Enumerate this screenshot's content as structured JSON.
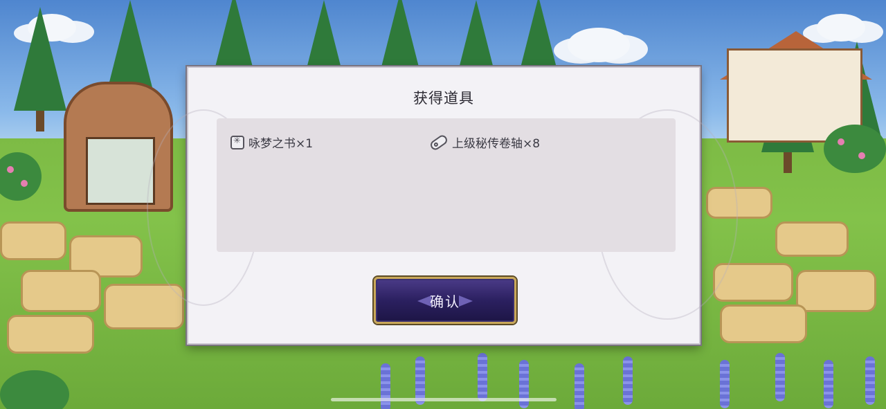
{
  "dialog": {
    "title": "获得道具",
    "items": [
      {
        "icon": "book-icon",
        "name": "咏梦之书×1"
      },
      {
        "icon": "scroll-icon",
        "name": "上级秘传卷轴×8"
      }
    ],
    "confirm_label": "确认"
  },
  "colors": {
    "dialog_bg": "#f3f2f6",
    "panel_bg": "#e3dee3",
    "button_bg": "#2b2060",
    "button_border": "#c9a85a"
  }
}
